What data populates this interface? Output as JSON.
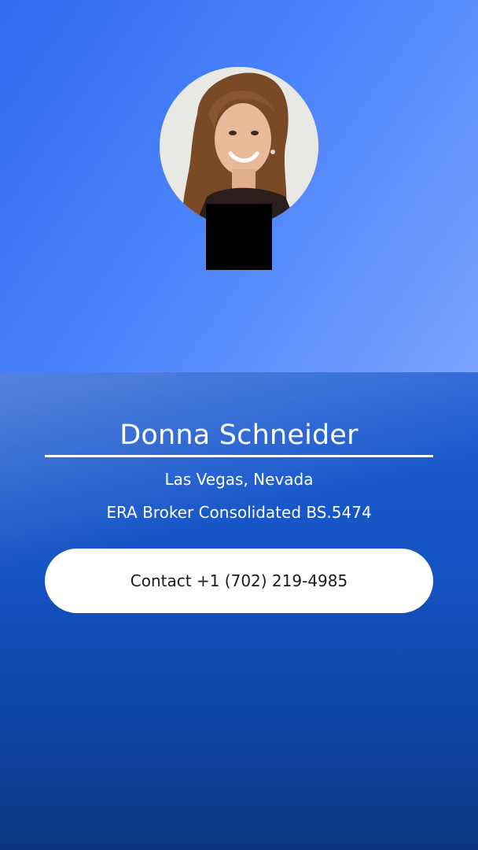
{
  "profile": {
    "name": "Donna Schneider",
    "location": "Las Vegas, Nevada",
    "brokerage": "ERA Broker Consolidated BS.5474",
    "avatar_alt": "Donna Schneider"
  },
  "contact": {
    "label": "Contact +1 (702) 219-4985"
  },
  "colors": {
    "top_gradient_start": "#2f6af0",
    "top_gradient_end": "#7aa3ff",
    "bottom_gradient_start": "#1f5fd4",
    "bottom_gradient_end": "#0b377f",
    "button_bg": "#ffffff",
    "text": "#ffffff"
  }
}
